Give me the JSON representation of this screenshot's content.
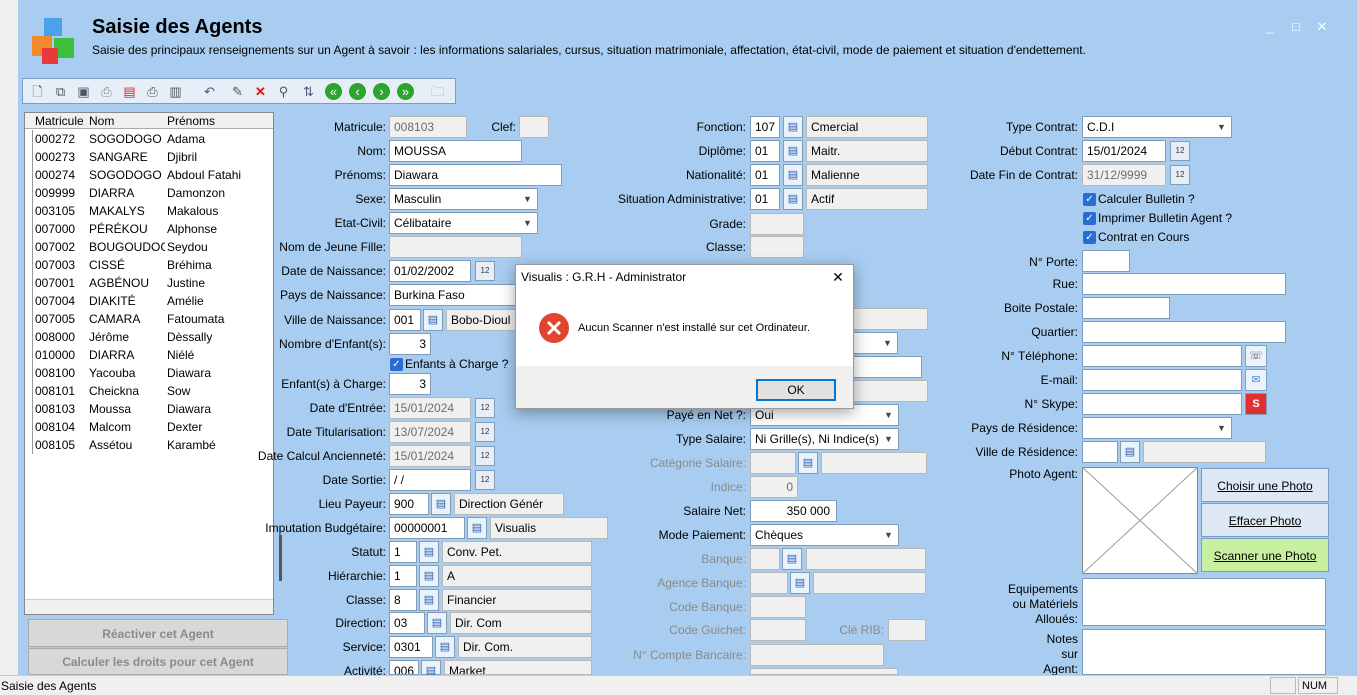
{
  "window": {
    "title": "Saisie des Agents",
    "subtitle": "Saisie des principaux renseignements sur un Agent à savoir : les informations salariales, cursus, situation matrimoniale, affectation, état-civil, mode de paiement et situation d'endettement.",
    "minimize": "_",
    "maximize": "□",
    "close": "✕"
  },
  "toolbar": {
    "icons": [
      "new-icon",
      "copy-icon",
      "save-icon",
      "print-preview-icon",
      "pdf-icon",
      "print-icon",
      "export-icon",
      "undo-icon",
      "edit-icon",
      "delete-icon",
      "search-icon",
      "refresh-icon",
      "first-icon",
      "previous-icon",
      "next-icon",
      "last-icon",
      "folder-icon"
    ]
  },
  "grid": {
    "columns": [
      "Matricule",
      "Nom",
      "Prénoms"
    ],
    "rows": [
      [
        "000272",
        "SOGODOGO",
        "Adama"
      ],
      [
        "000273",
        "SANGARE",
        "Djibril"
      ],
      [
        "000274",
        "SOGODOGO",
        "Abdoul Fatahi"
      ],
      [
        "009999",
        "DIARRA",
        "Damonzon"
      ],
      [
        "003105",
        "MAKALYS",
        "Makalous"
      ],
      [
        "007000",
        "PÉRÉKOU",
        "Alphonse"
      ],
      [
        "007002",
        "BOUGOUDOG",
        "Seydou"
      ],
      [
        "007003",
        "CISSÉ",
        "Bréhima"
      ],
      [
        "007001",
        "AGBÉNOU",
        "Justine"
      ],
      [
        "007004",
        "DIAKITÉ",
        "Amélie"
      ],
      [
        "007005",
        "CAMARA",
        "Fatoumata"
      ],
      [
        "008000",
        "Jérôme",
        "Dèssally"
      ],
      [
        "010000",
        "DIARRA",
        "Niélé"
      ],
      [
        "008100",
        "Yacouba",
        "Diawara"
      ],
      [
        "008101",
        "Cheickna",
        "Sow"
      ],
      [
        "008103",
        "Moussa",
        "Diawara"
      ],
      [
        "008104",
        "Malcom",
        "Dexter"
      ],
      [
        "008105",
        "Assétou",
        "Karambé"
      ]
    ]
  },
  "buttons": {
    "reactivate": "Réactiver cet Agent",
    "compute_rights": "Calculer les droits pour cet Agent",
    "choose_photo": "Choisir une Photo",
    "erase_photo": "Effacer  Photo",
    "scan_photo": "Scanner une Photo"
  },
  "col1": {
    "matricule": {
      "label": "Matricule:",
      "value": "008103"
    },
    "clef": {
      "label": "Clef:",
      "value": ""
    },
    "nom": {
      "label": "Nom:",
      "value": "MOUSSA"
    },
    "prenoms": {
      "label": "Prénoms:",
      "value": "Diawara"
    },
    "sexe": {
      "label": "Sexe:",
      "value": "Masculin"
    },
    "etat_civil": {
      "label": "Etat-Civil:",
      "value": "Célibataire"
    },
    "nom_jeune_fille": {
      "label": "Nom de Jeune Fille:",
      "value": ""
    },
    "date_naissance": {
      "label": "Date de Naissance:",
      "value": "01/02/2002"
    },
    "pays_naissance": {
      "label": "Pays de Naissance:",
      "value": "Burkina Faso"
    },
    "ville_naissance": {
      "label": "Ville de Naissance:",
      "code": "001",
      "value": "Bobo-Dioul"
    },
    "nb_enfants": {
      "label": "Nombre d'Enfant(s):",
      "value": "3"
    },
    "enfants_charge_chk": {
      "label": "Enfants à Charge ?"
    },
    "enfants_charge": {
      "label": "Enfant(s) à Charge:",
      "value": "3"
    },
    "date_entree": {
      "label": "Date d'Entrée:",
      "value": "15/01/2024"
    },
    "date_titularisation": {
      "label": "Date Titularisation:",
      "value": "13/07/2024"
    },
    "date_anciennete": {
      "label": "Date Calcul Ancienneté:",
      "value": "15/01/2024"
    },
    "date_sortie": {
      "label": "Date Sortie:",
      "value": " / /"
    },
    "lieu_payeur": {
      "label": "Lieu Payeur:",
      "code": "900",
      "value": "Direction Génér"
    },
    "imputation": {
      "label": "Imputation Budgétaire:",
      "code": "00000001",
      "value": "Visualis"
    },
    "statut": {
      "label": "Statut:",
      "code": "1",
      "value": "Conv. Pet."
    },
    "hierarchie": {
      "label": "Hiérarchie:",
      "code": "1",
      "value": "A"
    },
    "classe": {
      "label": "Classe:",
      "code": "8",
      "value": "Financier"
    },
    "direction": {
      "label": "Direction:",
      "code": "03",
      "value": "Dir. Com"
    },
    "service": {
      "label": "Service:",
      "code": "0301",
      "value": "Dir. Com."
    },
    "activite": {
      "label": "Activité:",
      "code": "006",
      "value": "Market"
    }
  },
  "col2": {
    "fonction": {
      "label": "Fonction:",
      "code": "107",
      "value": "Cmercial"
    },
    "diplome": {
      "label": "Diplôme:",
      "code": "01",
      "value": "Maitr."
    },
    "nationalite": {
      "label": "Nationalité:",
      "code": "01",
      "value": "Malienne"
    },
    "situation_admin": {
      "label": "Situation Administrative:",
      "code": "01",
      "value": "Actif"
    },
    "grade": {
      "label": "Grade:"
    },
    "classe2": {
      "label": "Classe:"
    },
    "paye_net": {
      "label": "Payé en Net ?:",
      "value": "Oui"
    },
    "type_salaire": {
      "label": "Type Salaire:",
      "value": "Ni Grille(s), Ni Indice(s)"
    },
    "categorie_salaire": {
      "label": "Catégorie Salaire:"
    },
    "indice": {
      "label": "Indice:",
      "value": "0"
    },
    "salaire_net": {
      "label": "Salaire Net:",
      "value": "350 000"
    },
    "mode_paiement": {
      "label": "Mode Paiement:",
      "value": "Chèques"
    },
    "banque": {
      "label": "Banque:"
    },
    "agence_banque": {
      "label": "Agence Banque:"
    },
    "code_banque": {
      "label": "Code Banque:"
    },
    "code_guichet": {
      "label": "Code Guichet:"
    },
    "cle_rib": {
      "label": "Clé RIB:"
    },
    "compte_bancaire": {
      "label": "N° Compte Bancaire:"
    }
  },
  "col3": {
    "type_contrat": {
      "label": "Type Contrat:",
      "value": "C.D.I"
    },
    "debut_contrat": {
      "label": "Début Contrat:",
      "value": "15/01/2024"
    },
    "fin_contrat": {
      "label": "Date Fin de Contrat:",
      "value": "31/12/9999"
    },
    "calculer_bulletin": {
      "label": "Calculer Bulletin ?"
    },
    "imprimer_bulletin": {
      "label": "Imprimer Bulletin Agent ?"
    },
    "contrat_en_cours": {
      "label": "Contrat en Cours"
    },
    "porte": {
      "label": "N° Porte:"
    },
    "rue": {
      "label": "Rue:"
    },
    "boite_postale": {
      "label": "Boite Postale:"
    },
    "quartier": {
      "label": "Quartier:"
    },
    "telephone": {
      "label": "N° Téléphone:"
    },
    "email": {
      "label": "E-mail:"
    },
    "skype": {
      "label": "N° Skype:"
    },
    "pays_residence": {
      "label": "Pays de Résidence:"
    },
    "ville_residence": {
      "label": "Ville de Résidence:"
    },
    "photo_agent": {
      "label": "Photo Agent:"
    },
    "equipements": {
      "label1": "Equipements",
      "label2": "ou Matériels",
      "label3": "Alloués:"
    },
    "notes": {
      "label1": "Notes",
      "label2": "sur",
      "label3": "Agent:"
    }
  },
  "dialog": {
    "title": "Visualis : G.R.H - Administrator",
    "message": "Aucun Scanner n'est installé sur cet Ordinateur.",
    "ok": "OK",
    "close": "✕"
  },
  "statusbar": {
    "text": "Saisie des Agents",
    "num": "NUM"
  },
  "colors": {
    "panel": "#a8cdf0",
    "error": "#e0452f",
    "checkbox": "#2b6bd4",
    "scan_button": "#c9f0a0"
  }
}
